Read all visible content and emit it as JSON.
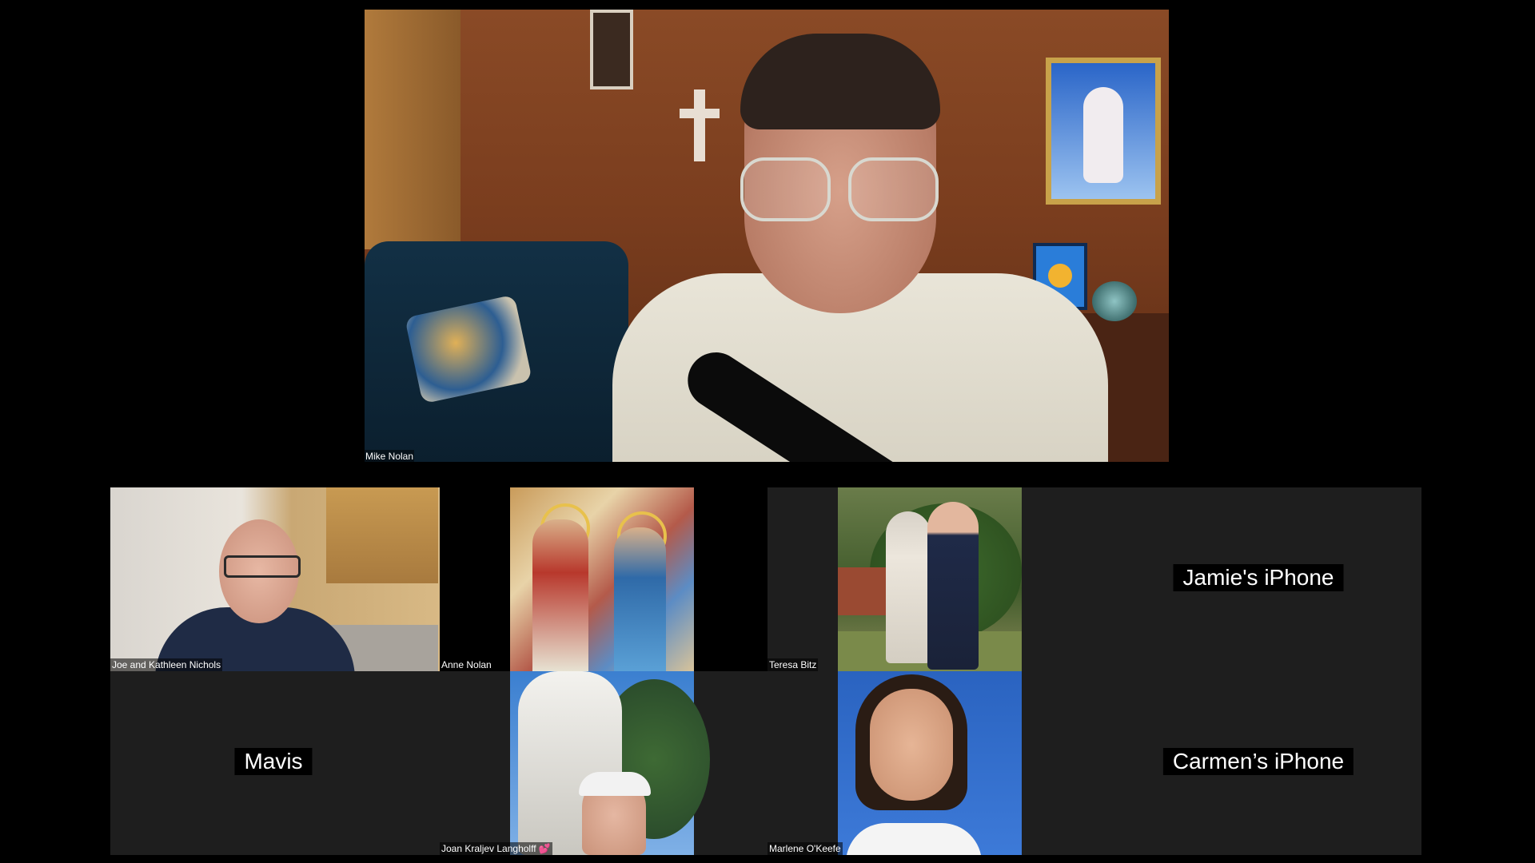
{
  "active_speaker": {
    "name": "Mike Nolan"
  },
  "participants": [
    {
      "id": "joe",
      "name": "Joe and Kathleen Nichols",
      "video": true
    },
    {
      "id": "anne",
      "name": "Anne Nolan",
      "video": true
    },
    {
      "id": "teresa",
      "name": "Teresa Bitz",
      "video": true
    },
    {
      "id": "jamie",
      "name": "Jamie's iPhone",
      "video": false
    },
    {
      "id": "mavis",
      "name": "Mavis",
      "video": false
    },
    {
      "id": "joan",
      "name": "Joan Kraljev Langholff 💕",
      "video": true
    },
    {
      "id": "marlene",
      "name": "Marlene O'Keefe",
      "video": true
    },
    {
      "id": "carmen",
      "name": "Carmen’s iPhone",
      "video": false
    }
  ],
  "colors": {
    "background": "#000000",
    "tile_off": "#1e1e1e",
    "name_text": "#ffffff"
  }
}
